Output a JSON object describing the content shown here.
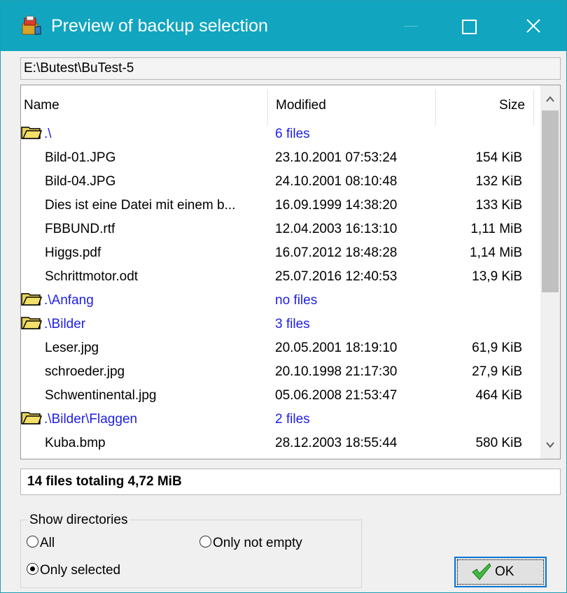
{
  "window": {
    "title": "Preview of backup selection",
    "accent_color": "#11a5c0"
  },
  "path": "E:\\Butest\\BuTest-5",
  "list": {
    "columns": {
      "name": "Name",
      "modified": "Modified",
      "size": "Size"
    },
    "rows": [
      {
        "type": "dir",
        "name": ".\\",
        "modified": "6 files",
        "size": ""
      },
      {
        "type": "file",
        "name": "Bild-01.JPG",
        "modified": "23.10.2001 07:53:24",
        "size": "154 KiB"
      },
      {
        "type": "file",
        "name": "Bild-04.JPG",
        "modified": "24.10.2001 08:10:48",
        "size": "132 KiB"
      },
      {
        "type": "file",
        "name": "Dies ist eine Datei mit einem b...",
        "modified": "16.09.1999 14:38:20",
        "size": "133 KiB"
      },
      {
        "type": "file",
        "name": "FBBUND.rtf",
        "modified": "12.04.2003 16:13:10",
        "size": "1,11 MiB"
      },
      {
        "type": "file",
        "name": "Higgs.pdf",
        "modified": "16.07.2012 18:48:28",
        "size": "1,14 MiB"
      },
      {
        "type": "file",
        "name": "Schrittmotor.odt",
        "modified": "25.07.2016 12:40:53",
        "size": "13,9 KiB"
      },
      {
        "type": "dir",
        "name": ".\\Anfang",
        "modified": "no files",
        "size": ""
      },
      {
        "type": "dir",
        "name": ".\\Bilder",
        "modified": "3 files",
        "size": ""
      },
      {
        "type": "file",
        "name": "Leser.jpg",
        "modified": "20.05.2001 18:19:10",
        "size": "61,9 KiB"
      },
      {
        "type": "file",
        "name": "schroeder.jpg",
        "modified": "20.10.1998 21:17:30",
        "size": "27,9 KiB"
      },
      {
        "type": "file",
        "name": "Schwentinental.jpg",
        "modified": "05.06.2008 21:53:47",
        "size": "464 KiB"
      },
      {
        "type": "dir",
        "name": ".\\Bilder\\Flaggen",
        "modified": "2 files",
        "size": ""
      },
      {
        "type": "file",
        "name": "Kuba.bmp",
        "modified": "28.12.2003 18:55:44",
        "size": "580 KiB"
      }
    ],
    "scroll_position": 0
  },
  "summary": "14 files totaling 4,72 MiB",
  "show_directories": {
    "title": "Show directories",
    "options": {
      "all": "All",
      "only_not_empty": "Only not empty",
      "only_selected": "Only selected"
    },
    "selected": "only_selected"
  },
  "ok_button": {
    "label": "OK"
  },
  "icons": {
    "app": "backup-app-icon",
    "folder": "folder-icon",
    "ok": "checkmark-icon"
  }
}
